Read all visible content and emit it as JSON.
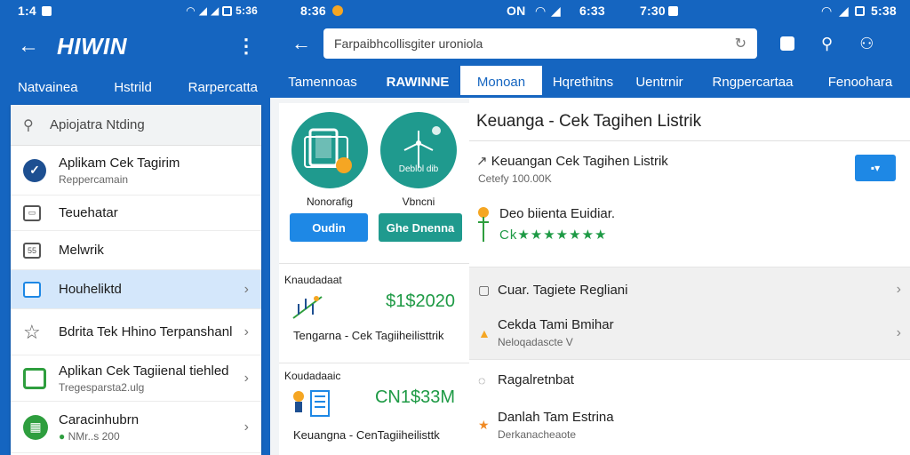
{
  "left_phone": {
    "status": {
      "time": "1:4",
      "right_time": "5:36"
    },
    "app_title": "HIWIN",
    "tabs": [
      "Natvainea",
      "Hstrild",
      "Rarpercatta"
    ],
    "search": {
      "placeholder": "Apiojatra Ntding"
    },
    "items": [
      {
        "label": "Aplikam Cek Tagirim",
        "sub": "Reppercamain",
        "icon": "check-circle-icon"
      },
      {
        "label": "Teuehatar",
        "sub": "",
        "icon": "image-icon"
      },
      {
        "label": "Melwrik",
        "sub": "",
        "icon": "document-icon"
      },
      {
        "label": "Houheliktd",
        "sub": "",
        "icon": "calendar-icon"
      },
      {
        "label": "Bdrita Tek Hhino Terpanshanl",
        "sub": "",
        "icon": "star-icon"
      },
      {
        "label": "Aplikan Cek Tagiienal tiehled",
        "sub": "Tregesparsta2.ulg",
        "icon": "calendar-green-icon"
      },
      {
        "label": "Caracinhubrn",
        "sub": "NMr..s 200",
        "icon": "grid-green-icon"
      }
    ]
  },
  "right_tablet": {
    "status": {
      "left_time": "8:36",
      "center": "ON",
      "center_time": "6:33",
      "right_time": "7:30",
      "far_right_time": "5:38"
    },
    "search": {
      "value": "Farpaibhcollisgiter uroniola"
    },
    "tabs": [
      "Tamennoas",
      "RAWINNE",
      "Monoan",
      "Hqrethitns",
      "Uentrnir",
      "Rngpercartaa",
      "Fenoohara"
    ],
    "selected_tab_index": 2,
    "apps": [
      {
        "name": "Nonorafig",
        "button": "Oudin"
      },
      {
        "name": "Vbncni",
        "button": "Ghe Dnenna",
        "badge": "Deblol dib"
      }
    ],
    "deals": [
      {
        "header": "Knaudadaat",
        "amount": "$1$2020",
        "name": "Tengarna - Cek Tagiiheilisttrik"
      },
      {
        "header": "Koudadaaic",
        "amount": "CN1$33M",
        "name": "Keuangna - CenTagiiheilisttk"
      }
    ],
    "detail": {
      "title": "Keuanga - Cek Tagihen Listrik",
      "row1": {
        "main": "Keuangan Cek Tagihen Listrik",
        "sub": "Cetefy 100.00K"
      },
      "row2": {
        "main": "Deo biienta Euidiar.",
        "stars": "Ck★★★★★★★"
      },
      "mid_rows": [
        {
          "main": "Cuar. Tagiete Regliani",
          "sub": ""
        },
        {
          "main": "Cekda Tami Bmihar",
          "sub": "Neloqadascte V"
        }
      ],
      "bot_rows": [
        {
          "main": "Ragalretnbat",
          "sub": ""
        },
        {
          "main": "Danlah Tam Estrina",
          "sub": "Derkanacheaote"
        }
      ]
    }
  },
  "colors": {
    "primary": "#1565c0",
    "teal": "#1f9a8e",
    "green": "#1e9a45",
    "accent_blue": "#1e88e5"
  }
}
